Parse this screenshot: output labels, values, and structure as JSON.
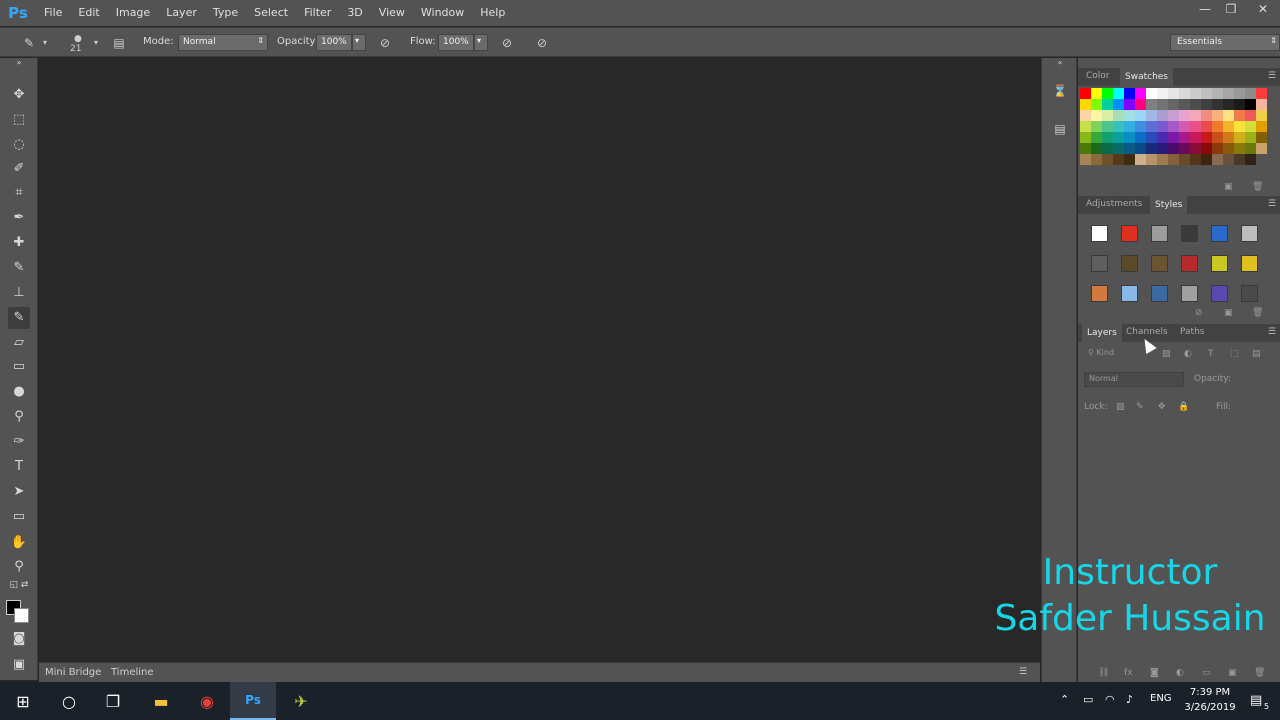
{
  "app": {
    "logo": "Ps"
  },
  "menu": [
    "File",
    "Edit",
    "Image",
    "Layer",
    "Type",
    "Select",
    "Filter",
    "3D",
    "View",
    "Window",
    "Help"
  ],
  "window_controls": {
    "minimize": "—",
    "restore": "❐",
    "close": "✕"
  },
  "options": {
    "brush_size": "21",
    "mode_label": "Mode:",
    "mode_value": "Normal",
    "opacity_label": "Opacity:",
    "opacity_value": "100%",
    "flow_label": "Flow:",
    "flow_value": "100%",
    "workspace": "Essentials"
  },
  "bottom_tabs": [
    "Mini Bridge",
    "Timeline"
  ],
  "panels": {
    "color_tabs": [
      "Color",
      "Swatches"
    ],
    "style_tabs": [
      "Adjustments",
      "Styles"
    ],
    "layer_tabs": [
      "Layers",
      "Channels",
      "Paths"
    ],
    "kind_label": "Kind",
    "blend_mode": "Normal",
    "opacity_label": "Opacity:",
    "lock_label": "Lock:",
    "fill_label": "Fill:"
  },
  "colors": {
    "swatches": [
      "#ff0000",
      "#ffff00",
      "#00ff00",
      "#00ffff",
      "#0000ff",
      "#ff00ff",
      "#ffffff",
      "#f2f2f2",
      "#e5e5e5",
      "#d9d9d9",
      "#cccccc",
      "#bfbfbf",
      "#b3b3b3",
      "#a6a6a6",
      "#999999",
      "#8c8c8c",
      "#ff3b3b",
      "#ffd800",
      "#7fff00",
      "#00d0a0",
      "#0090ff",
      "#8000ff",
      "#ff0080",
      "#808080",
      "#737373",
      "#666666",
      "#595959",
      "#4d4d4d",
      "#404040",
      "#333333",
      "#262626",
      "#1a1a1a",
      "#000000",
      "#f7b2a0",
      "#f9d4a4",
      "#fff6a5",
      "#d9efa5",
      "#a8deb5",
      "#a0e0e0",
      "#9ad6f5",
      "#a1b8e6",
      "#a99dd1",
      "#c89fd1",
      "#e8a3d0",
      "#f5a6b8",
      "#f28b82",
      "#f9b37a",
      "#ffe082",
      "#f37a4a",
      "#f05a5a",
      "#f3d04a",
      "#c6e04d",
      "#7fd35a",
      "#4ec48c",
      "#36c0c0",
      "#32aee0",
      "#3c8ee0",
      "#5c6fd6",
      "#7b5ad0",
      "#a65ac8",
      "#d25aaf",
      "#e9508a",
      "#e94b4b",
      "#f07a2a",
      "#f5b32a",
      "#f9e23a",
      "#d4e03a",
      "#e0a000",
      "#8aba1a",
      "#38a83a",
      "#12a070",
      "#0aa0a0",
      "#0a8ec6",
      "#0a6ec6",
      "#2a4ab8",
      "#4a2ab0",
      "#7a1aa8",
      "#a81a8a",
      "#c81a5a",
      "#c81a1a",
      "#c8501a",
      "#d07a1a",
      "#d0b01a",
      "#a0b01a",
      "#806000",
      "#4a7a0a",
      "#1a6a1a",
      "#0a6a4a",
      "#0a6a6a",
      "#0a5a86",
      "#0a4a86",
      "#1a2a7a",
      "#2a1a7a",
      "#4a0a6a",
      "#6a0a5a",
      "#8a0a3a",
      "#8a0a0a",
      "#8a3a0a",
      "#8a5a0a",
      "#8a7a0a",
      "#6a7a0a",
      "#c9a36a",
      "#a88452",
      "#8a6a3a",
      "#6e502a",
      "#55391a",
      "#3f2a12",
      "#ceb08c",
      "#b8936a",
      "#9f7950",
      "#86603a",
      "#6c4a28",
      "#53351a",
      "#3d2510",
      "#8a6a50",
      "#6a5040",
      "#4a3828",
      "#302418"
    ],
    "styles": [
      "#ffffff",
      "#e03020",
      "#9c9c9c",
      "#3a3a3a",
      "#2a6acf",
      "#bdbdbd",
      "#5e5e5e",
      "#5a4a28",
      "#6a5530",
      "#b82a2a",
      "#c8c820",
      "#e0c020",
      "#d07a40",
      "#88b8e8",
      "#3a6aa0",
      "#a0a0a0",
      "#5a4ab0",
      "#4a4a4a"
    ]
  },
  "watermark": {
    "line1": "Instructor",
    "line2": "Safder Hussain"
  },
  "taskbar": {
    "lang": "ENG",
    "time": "7:39 PM",
    "date": "3/26/2019",
    "notification_count": "5"
  }
}
